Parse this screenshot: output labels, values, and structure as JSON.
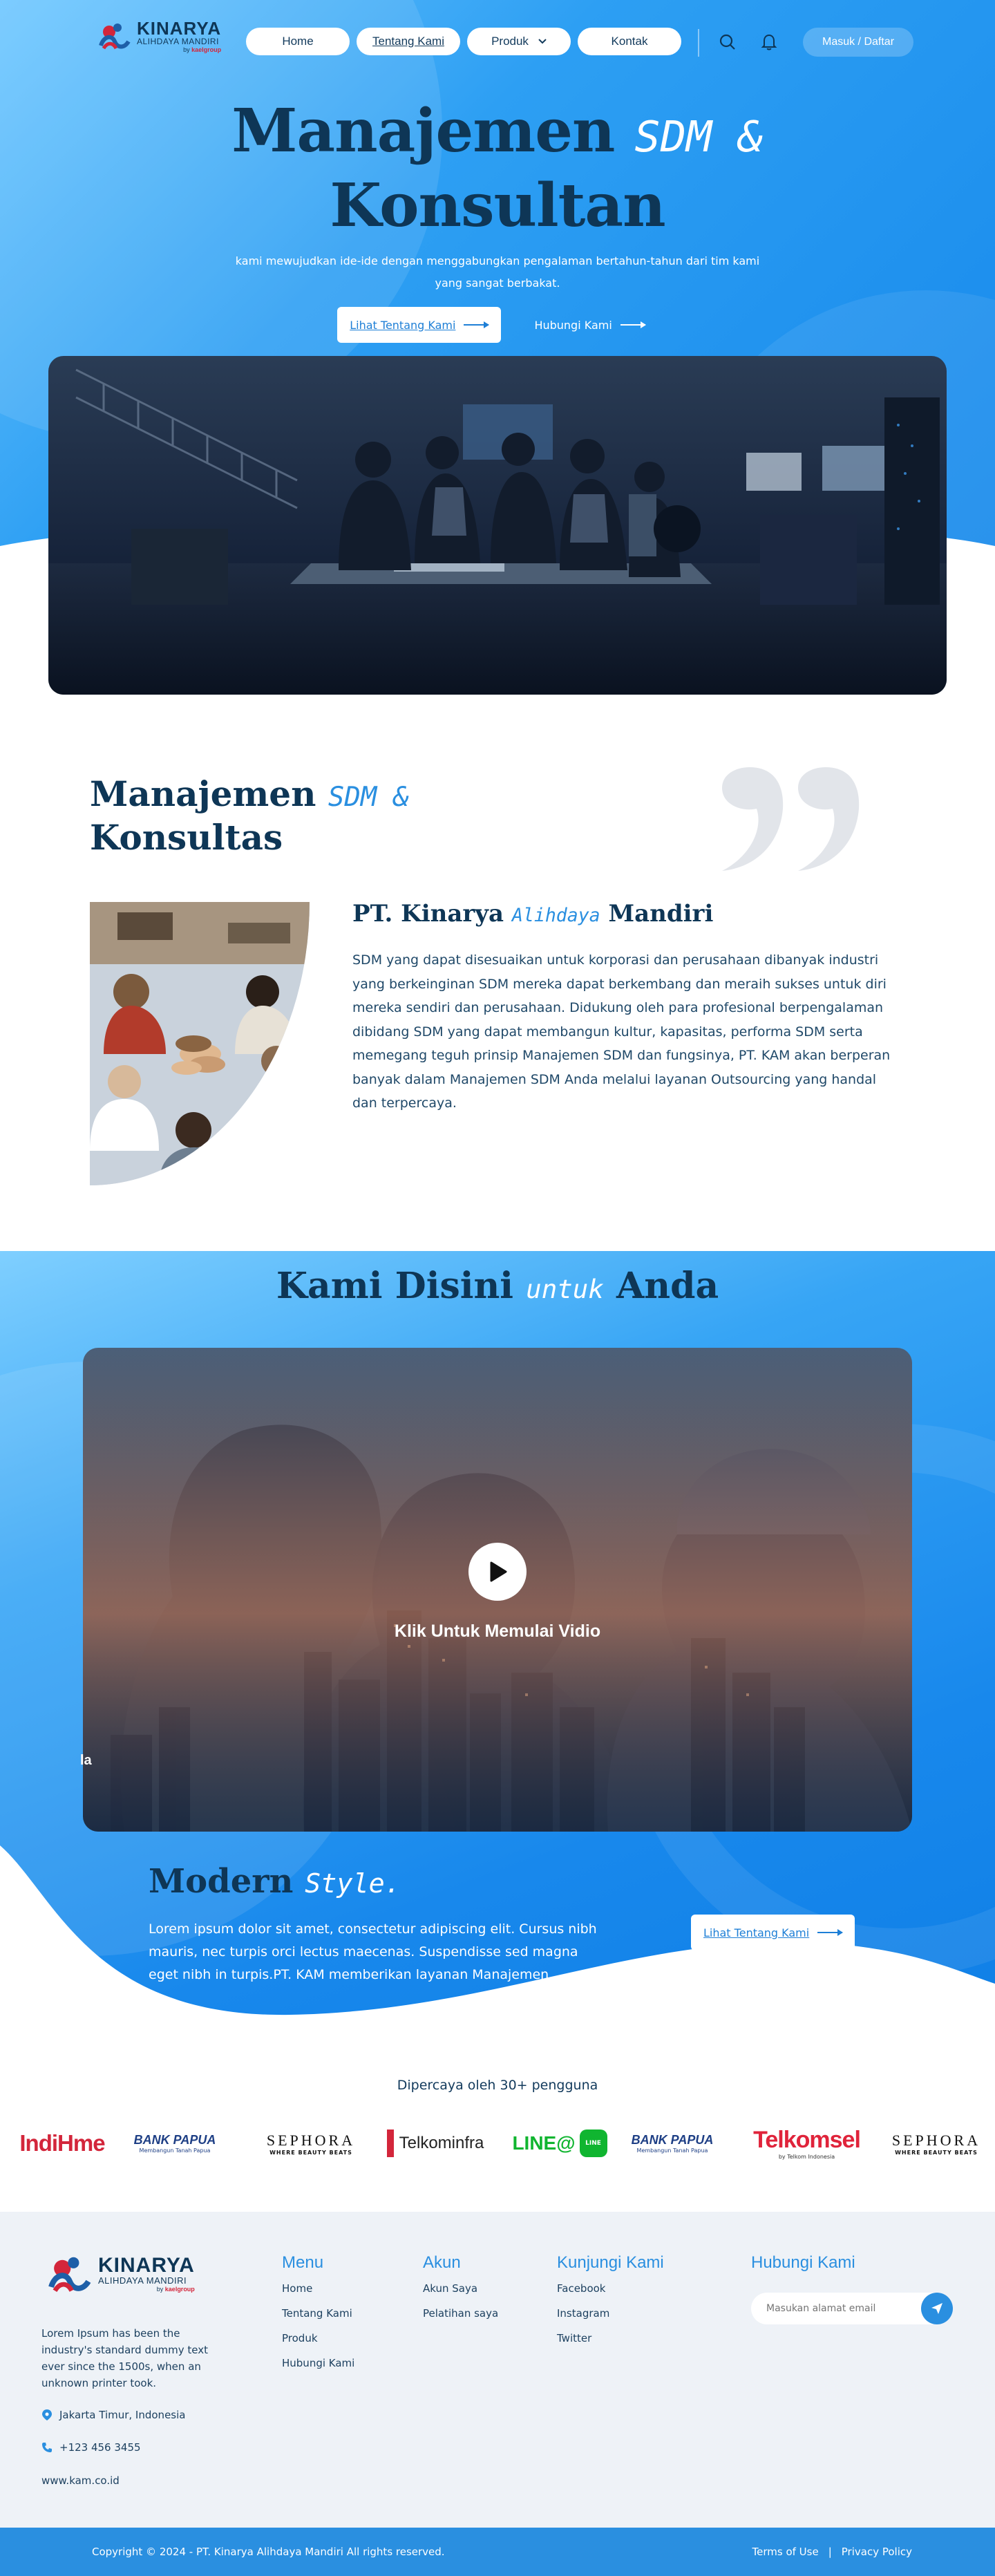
{
  "nav": {
    "logo_name": "KINARYA",
    "logo_sub": "ALIHDAYA MANDIRI",
    "logo_by": "by",
    "logo_by_brand": "kaelgroup",
    "links": [
      "Home",
      "Tentang Kami",
      "Produk",
      "Kontak"
    ],
    "login": "Masuk / Daftar"
  },
  "hero": {
    "title_part1": "Manajemen",
    "title_script": "SDM &",
    "title_part2": "Konsultan",
    "subtitle": "kami mewujudkan ide-ide dengan menggabungkan pengalaman bertahun-tahun dari tim kami yang sangat berbakat.",
    "btn_primary": "Lihat Tentang Kami",
    "btn_secondary": "Hubungi Kami"
  },
  "about": {
    "title_part1": "Manajemen",
    "title_script": "SDM &",
    "title_part2": "Konsultas",
    "company_part1": "PT. Kinarya",
    "company_script": "Alihdaya",
    "company_part2": "Mandiri",
    "body": "SDM yang dapat disesuaikan untuk korporasi dan perusahaan dibanyak industri yang berkeinginan SDM mereka dapat berkembang dan meraih sukses untuk diri mereka sendiri dan perusahaan. Didukung oleh para profesional berpengalaman dibidang SDM yang dapat membangun kultur, kapasitas, performa SDM serta memegang teguh prinsip Manajemen SDM dan fungsinya, PT. KAM akan berperan banyak dalam Manajemen SDM Anda melalui layanan Outsourcing yang handal dan terpercaya."
  },
  "video": {
    "title_part1": "Kami Disini",
    "title_script": "untuk",
    "title_part2": "Anda",
    "play_label": "Klik Untuk Memulai Vidio",
    "edge_text": "la"
  },
  "modern": {
    "title": "Modern",
    "title_script": "Style.",
    "body": "Lorem ipsum dolor sit amet, consectetur adipiscing elit. Cursus nibh mauris, nec turpis orci lectus maecenas. Suspendisse sed magna eget nibh in turpis.PT. KAM memberikan layanan Manajemen",
    "button": "Lihat Tentang Kami"
  },
  "partners": {
    "title": "Dipercaya oleh 30+ pengguna",
    "logos": [
      {
        "name": "IndiHome",
        "a": "Indi",
        "b": "H",
        "c": "me"
      },
      {
        "name": "Bank Papua",
        "text": "BANK PAPUA",
        "tag": "Membangun Tanah Papua"
      },
      {
        "name": "Sephora",
        "text": "SEPHORA",
        "tag": "WHERE BEAUTY BEATS"
      },
      {
        "name": "Telkom Infra",
        "text": "Telkominfra"
      },
      {
        "name": "LINE@",
        "text": "LINE@",
        "badge": "LINE"
      },
      {
        "name": "Bank Papua",
        "text": "BANK PAPUA",
        "tag": "Membangun Tanah Papua"
      },
      {
        "name": "Telkomsel",
        "text": "Telkomsel",
        "tag": "by Telkom Indonesia"
      },
      {
        "name": "Sephora",
        "text": "SEPHORA",
        "tag": "WHERE BEAUTY BEATS"
      }
    ]
  },
  "footer": {
    "desc": "Lorem Ipsum has been the industry's standard dummy text ever since the 1500s, when an unknown printer took.",
    "location": "Jakarta Timur, Indonesia",
    "phone": "+123 456 3455",
    "website": "www.kam.co.id",
    "menu_title": "Menu",
    "menu": [
      "Home",
      "Tentang Kami",
      "Produk",
      "Hubungi Kami"
    ],
    "akun_title": "Akun",
    "akun": [
      "Akun Saya",
      "Pelatihan saya"
    ],
    "visit_title": "Kunjungi Kami",
    "visit": [
      "Facebook",
      "Instagram",
      "Twitter"
    ],
    "contact_title": "Hubungi Kami",
    "email_placeholder": "Masukan alamat email",
    "copyright": "Copyright © 2024 - PT. Kinarya Alihdaya Mandiri All rights reserved.",
    "terms": "Terms of Use",
    "sep": "|",
    "privacy": "Privacy Policy"
  },
  "colors": {
    "navy": "#0e3656",
    "brand_blue": "#2a8fe0",
    "hero_blue": "#1486ea",
    "accent_red": "#d3263b"
  },
  "icons": [
    "search-icon",
    "bell-icon",
    "chevron-down-icon",
    "arrow-right-icon",
    "play-icon",
    "location-icon",
    "phone-icon",
    "send-icon",
    "quote-icon"
  ]
}
